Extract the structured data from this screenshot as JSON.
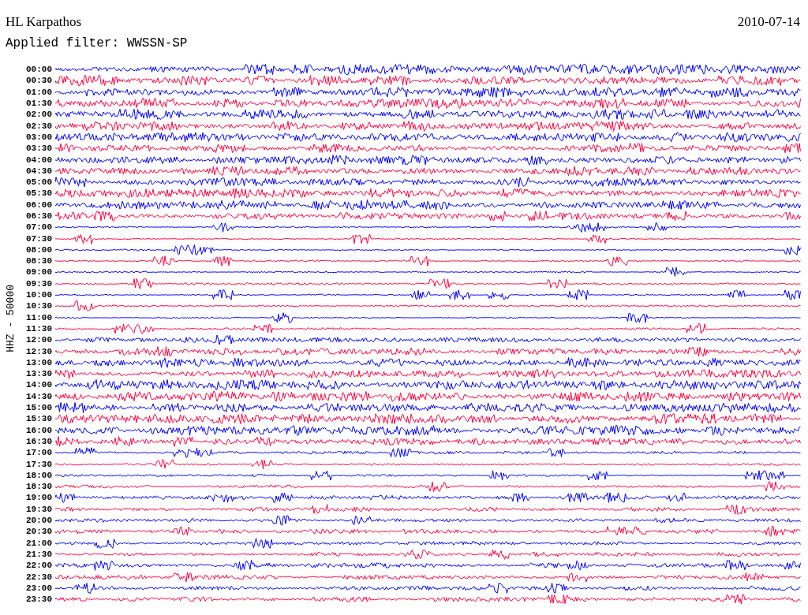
{
  "header": {
    "station": "HL Karpathos",
    "date": "2010-07-14",
    "filter": "Applied filter: WWSSN-SP"
  },
  "axis_label": "HHZ - 50000",
  "traces": [
    {
      "time": "00:00",
      "color": "#0000ff"
    },
    {
      "time": "00:30",
      "color": "#ff0040"
    },
    {
      "time": "01:00",
      "color": "#0000ff"
    },
    {
      "time": "01:30",
      "color": "#ff0040"
    },
    {
      "time": "02:00",
      "color": "#0000ff"
    },
    {
      "time": "02:30",
      "color": "#ff0040"
    },
    {
      "time": "03:00",
      "color": "#0000ff"
    },
    {
      "time": "03:30",
      "color": "#ff0040"
    },
    {
      "time": "04:00",
      "color": "#0000ff"
    },
    {
      "time": "04:30",
      "color": "#ff0040"
    },
    {
      "time": "05:00",
      "color": "#0000ff"
    },
    {
      "time": "05:30",
      "color": "#ff0040"
    },
    {
      "time": "06:00",
      "color": "#0000ff"
    },
    {
      "time": "06:30",
      "color": "#ff0040"
    },
    {
      "time": "07:00",
      "color": "#0000ff"
    },
    {
      "time": "07:30",
      "color": "#ff0040"
    },
    {
      "time": "08:00",
      "color": "#0000ff"
    },
    {
      "time": "08:30",
      "color": "#ff0040"
    },
    {
      "time": "09:00",
      "color": "#0000ff"
    },
    {
      "time": "09:30",
      "color": "#ff0040"
    },
    {
      "time": "10:00",
      "color": "#0000ff"
    },
    {
      "time": "10:30",
      "color": "#ff0040"
    },
    {
      "time": "11:00",
      "color": "#0000ff"
    },
    {
      "time": "11:30",
      "color": "#ff0040"
    },
    {
      "time": "12:00",
      "color": "#0000ff"
    },
    {
      "time": "12:30",
      "color": "#ff0040"
    },
    {
      "time": "13:00",
      "color": "#0000ff"
    },
    {
      "time": "13:30",
      "color": "#ff0040"
    },
    {
      "time": "14:00",
      "color": "#0000ff"
    },
    {
      "time": "14:30",
      "color": "#ff0040"
    },
    {
      "time": "15:00",
      "color": "#0000ff"
    },
    {
      "time": "15:30",
      "color": "#ff0040"
    },
    {
      "time": "16:00",
      "color": "#0000ff"
    },
    {
      "time": "16:30",
      "color": "#ff0040"
    },
    {
      "time": "17:00",
      "color": "#0000ff"
    },
    {
      "time": "17:30",
      "color": "#ff0040"
    },
    {
      "time": "18:00",
      "color": "#0000ff"
    },
    {
      "time": "18:30",
      "color": "#ff0040"
    },
    {
      "time": "19:00",
      "color": "#0000ff"
    },
    {
      "time": "19:30",
      "color": "#ff0040"
    },
    {
      "time": "20:00",
      "color": "#0000ff"
    },
    {
      "time": "20:30",
      "color": "#ff0040"
    },
    {
      "time": "21:00",
      "color": "#0000ff"
    },
    {
      "time": "21:30",
      "color": "#ff0040"
    },
    {
      "time": "22:00",
      "color": "#0000ff"
    },
    {
      "time": "22:30",
      "color": "#ff0040"
    },
    {
      "time": "23:00",
      "color": "#0000ff"
    },
    {
      "time": "23:30",
      "color": "#ff0040"
    }
  ]
}
